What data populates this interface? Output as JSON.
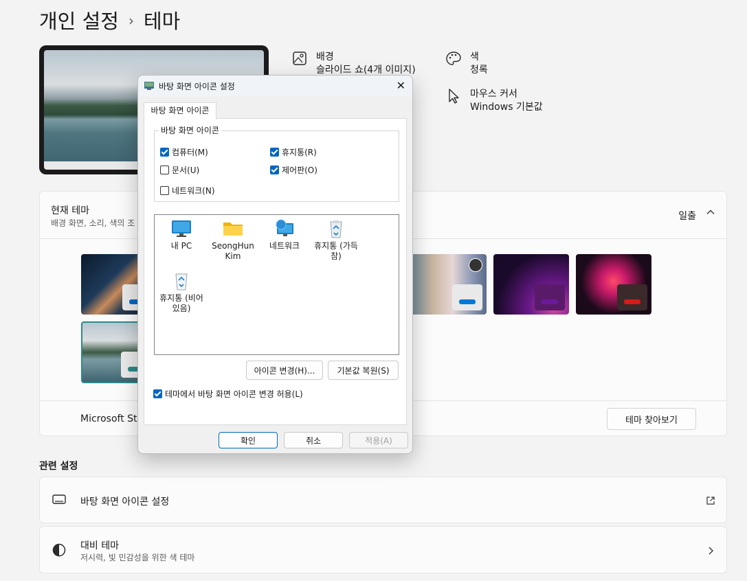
{
  "breadcrumb": {
    "parent": "개인 설정",
    "separator": "›",
    "current": "테마"
  },
  "theme_info": {
    "background_label": "배경",
    "background_value": "슬라이드 쇼(4개 이미지)",
    "color_label": "색",
    "color_value": "청록",
    "cursor_label": "마우스 커서",
    "cursor_value": "Windows 기본값"
  },
  "current_theme": {
    "title": "현재 테마",
    "subtitle": "배경 화면, 소리, 색의 조",
    "status": "일출",
    "store_label": "Microsoft Sto",
    "browse_button": "테마 찾아보기"
  },
  "related": {
    "title": "관련 설정",
    "desktop_icons": "바탕 화면 아이콘 설정",
    "contrast_title": "대비 테마",
    "contrast_sub": "저시력, 빛 민감성을 위한 색 테마"
  },
  "dialog": {
    "title": "바탕 화면 아이콘 설정",
    "tab": "바탕 화면 아이콘",
    "group_legend": "바탕 화면 아이콘",
    "checkboxes": {
      "computer": {
        "label": "컴퓨터(M)",
        "checked": true
      },
      "recycle": {
        "label": "휴지통(R)",
        "checked": true
      },
      "documents": {
        "label": "문서(U)",
        "checked": false
      },
      "control_panel": {
        "label": "제어판(O)",
        "checked": true
      },
      "network": {
        "label": "네트워크(N)",
        "checked": false
      }
    },
    "icons": {
      "pc": "내 PC",
      "user": "SeongHun Kim",
      "network": "네트워크",
      "recycle_full": "휴지통 (가득 참)",
      "recycle_empty": "휴지통 (비어 있음)"
    },
    "change_icon_button": "아이콘 변경(H)...",
    "restore_default_button": "기본값 복원(S)",
    "allow_themes_label": "테마에서 바탕 화면 아이콘 변경 허용(L)",
    "allow_themes_checked": true,
    "ok_button": "확인",
    "cancel_button": "취소",
    "apply_button": "적용(A)"
  },
  "colors": {
    "accent": "#0067c0",
    "teal": "#2d8a8a"
  }
}
